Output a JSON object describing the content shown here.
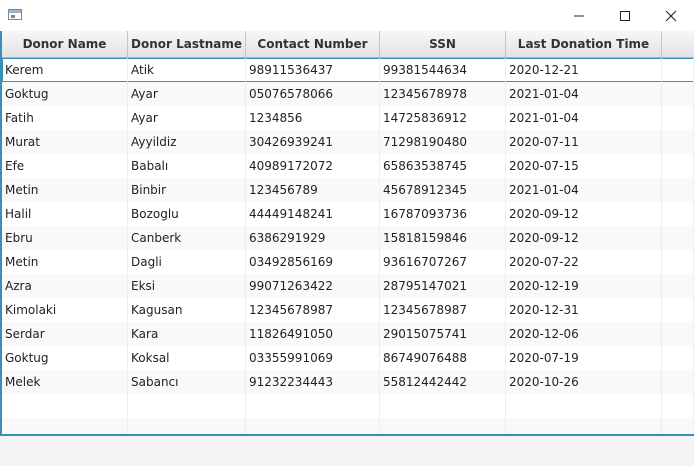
{
  "window": {
    "title": ""
  },
  "table": {
    "columns": [
      "Donor Name",
      "Donor Lastname",
      "Contact Number",
      "SSN",
      "Last Donation Time"
    ],
    "rows": [
      [
        "Kerem",
        "Atik",
        "98911536437",
        "99381544634",
        "2020-12-21"
      ],
      [
        "Goktug",
        "Ayar",
        "05076578066",
        "12345678978",
        "2021-01-04"
      ],
      [
        "Fatih",
        "Ayar",
        "1234856",
        "14725836912",
        "2021-01-04"
      ],
      [
        "Murat",
        "Ayyildiz",
        "30426939241",
        "71298190480",
        "2020-07-11"
      ],
      [
        "Efe",
        "Babalı",
        "40989172072",
        "65863538745",
        "2020-07-15"
      ],
      [
        "Metin",
        "Binbir",
        "123456789",
        "45678912345",
        "2021-01-04"
      ],
      [
        "Halil",
        "Bozoglu",
        "44449148241",
        "16787093736",
        "2020-09-12"
      ],
      [
        "Ebru",
        "Canberk",
        "6386291929",
        "15818159846",
        "2020-09-12"
      ],
      [
        "Metin",
        "Dagli",
        "03492856169",
        "93616707267",
        "2020-07-22"
      ],
      [
        "Azra",
        "Eksi",
        "99071263422",
        "28795147021",
        "2020-12-19"
      ],
      [
        "Kimolaki",
        "Kagusan",
        "12345678987",
        "12345678987",
        "2020-12-31"
      ],
      [
        "Serdar",
        "Kara",
        "11826491050",
        "29015075741",
        "2020-12-06"
      ],
      [
        "Goktug",
        "Koksal",
        "03355991069",
        "86749076488",
        "2020-07-19"
      ],
      [
        "Melek",
        "Sabancı",
        "91232234443",
        "55812442442",
        "2020-10-26"
      ]
    ]
  },
  "icons": {
    "app": "app-window-icon",
    "minimize": "minimize-icon",
    "maximize": "maximize-icon",
    "close": "close-icon"
  },
  "colors": {
    "focus": "#3a8fb7"
  }
}
